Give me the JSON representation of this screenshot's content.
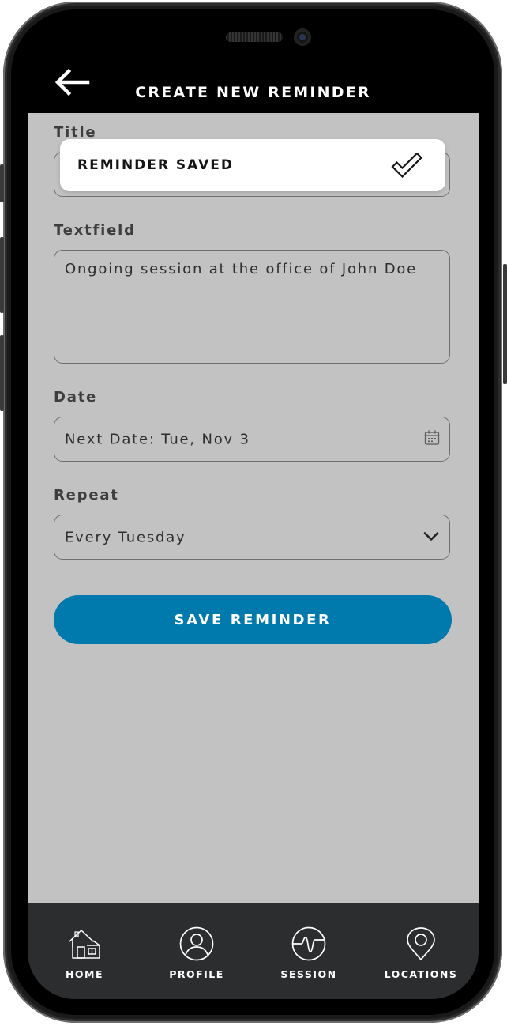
{
  "header": {
    "title": "CREATE NEW REMINDER"
  },
  "form": {
    "title_label": "Title",
    "textfield_label": "Textfield",
    "textfield_value": "Ongoing session at the office of John Doe",
    "date_label": "Date",
    "date_value": "Next Date: Tue, Nov 3",
    "repeat_label": "Repeat",
    "repeat_value": "Every Tuesday",
    "save_label": "SAVE REMINDER"
  },
  "toast": {
    "message": "REMINDER SAVED"
  },
  "nav": {
    "items": [
      {
        "label": "HOME",
        "icon": "home-icon"
      },
      {
        "label": "PROFILE",
        "icon": "profile-icon"
      },
      {
        "label": "SESSION",
        "icon": "session-icon"
      },
      {
        "label": "LOCATIONS",
        "icon": "location-pin-icon"
      }
    ]
  },
  "colors": {
    "accent": "#0079ac",
    "content_bg": "#c2c2c2",
    "nav_bg": "#2c2d2f",
    "toast_bg": "#ffffff"
  }
}
